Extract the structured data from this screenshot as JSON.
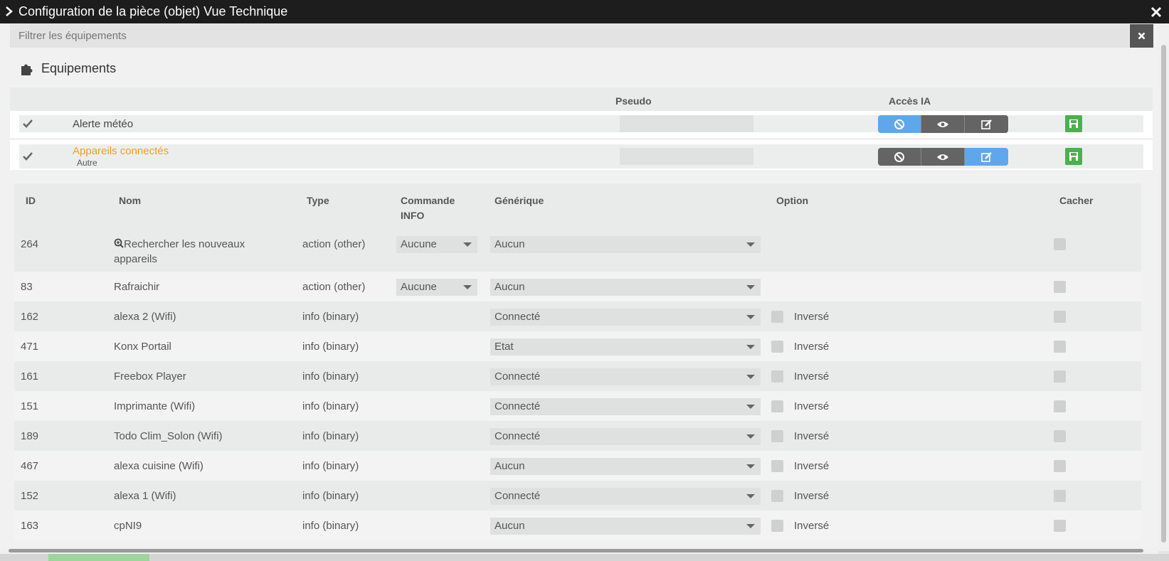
{
  "window": {
    "title": "Configuration de la pièce (objet) Vue Technique"
  },
  "filter": {
    "placeholder": "Filtrer les équipements"
  },
  "section": {
    "title": "Equipements"
  },
  "equipment_header": {
    "pseudo": "Pseudo",
    "acces_ia": "Accès IA"
  },
  "equipments": [
    {
      "name": "Alerte météo",
      "subtitle": "",
      "active_button": "ban"
    },
    {
      "name": "Appareils connectés",
      "subtitle": "Autre",
      "active_button": "edit"
    }
  ],
  "commands": {
    "headers": {
      "id": "ID",
      "nom": "Nom",
      "type": "Type",
      "commande_info": "Commande INFO",
      "generique": "Générique",
      "option": "Option",
      "cacher": "Cacher"
    },
    "rows": [
      {
        "id": "264",
        "nom": "Rechercher les nouveaux appareils",
        "type": "action (other)",
        "commande_info": "Aucune",
        "generique": "Aucun",
        "option": ""
      },
      {
        "id": "83",
        "nom": "Rafraichir",
        "type": "action (other)",
        "commande_info": "Aucune",
        "generique": "Aucun",
        "option": ""
      },
      {
        "id": "162",
        "nom": "alexa 2 (Wifi)",
        "type": "info (binary)",
        "commande_info": "",
        "generique": "Connecté",
        "option": "Inversé"
      },
      {
        "id": "471",
        "nom": "Konx Portail",
        "type": "info (binary)",
        "commande_info": "",
        "generique": "Etat",
        "option": "Inversé"
      },
      {
        "id": "161",
        "nom": "Freebox Player",
        "type": "info (binary)",
        "commande_info": "",
        "generique": "Connecté",
        "option": "Inversé"
      },
      {
        "id": "151",
        "nom": "Imprimante (Wifi)",
        "type": "info (binary)",
        "commande_info": "",
        "generique": "Connecté",
        "option": "Inversé"
      },
      {
        "id": "189",
        "nom": "Todo Clim_Solon (Wifi)",
        "type": "info (binary)",
        "commande_info": "",
        "generique": "Connecté",
        "option": "Inversé"
      },
      {
        "id": "467",
        "nom": "alexa cuisine (Wifi)",
        "type": "info (binary)",
        "commande_info": "",
        "generique": "Aucun",
        "option": "Inversé"
      },
      {
        "id": "152",
        "nom": "alexa 1 (Wifi)",
        "type": "info (binary)",
        "commande_info": "",
        "generique": "Connecté",
        "option": "Inversé"
      },
      {
        "id": "163",
        "nom": "cpNI9",
        "type": "info (binary)",
        "commande_info": "",
        "generique": "Aucun",
        "option": "Inversé"
      }
    ]
  },
  "colors": {
    "titlebar": "#1d1d1d",
    "accent_orange": "#f0a020",
    "button_blue": "#5fa7ec",
    "button_dark": "#646464",
    "save_green": "#4caf50"
  }
}
